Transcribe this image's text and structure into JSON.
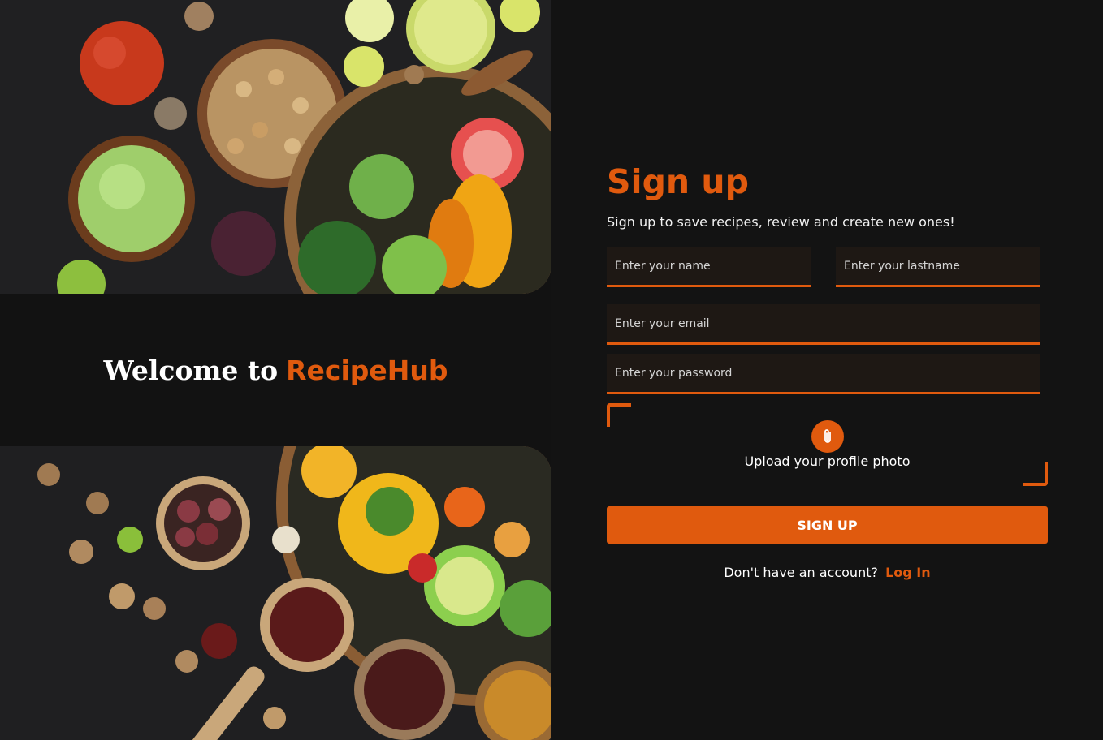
{
  "welcome": {
    "prefix": "Welcome to",
    "brand": "RecipeHub"
  },
  "form": {
    "title": "Sign up",
    "subtitle": "Sign up to save recipes, review and create new ones!",
    "name_placeholder": "Enter your name",
    "lastname_placeholder": "Enter your lastname",
    "email_placeholder": "Enter your email",
    "password_placeholder": "Enter your password",
    "upload_label": "Upload your profile photo",
    "upload_icon": "paperclip-icon",
    "submit_label": "SIGN UP",
    "login_prompt": "Don't have an account?",
    "login_link": "Log In"
  },
  "colors": {
    "accent": "#e05a0e",
    "background": "#131313",
    "field_background": "#1e1814"
  }
}
